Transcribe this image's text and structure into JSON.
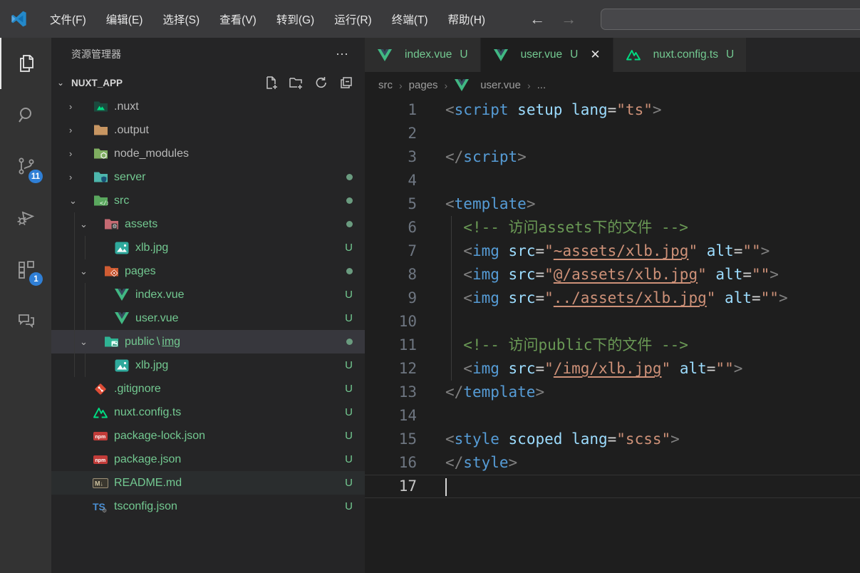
{
  "colors": {
    "titlebar_bg": "#3a3a3c",
    "activitybar_bg": "#333333",
    "sidebar_bg": "#252526",
    "editor_bg": "#1e1e1e",
    "tab_inactive_bg": "#2d2d2d",
    "selection_bg": "#37373d",
    "git_untracked_green": "#73c991",
    "badge_blue": "#2f7fd6",
    "tag_blue": "#569cd6",
    "attr_blue": "#9cdcfe",
    "string_orange": "#ce9178",
    "comment_green": "#6a9955"
  },
  "titlebar": {
    "logo_icon": "vscode-logo",
    "menus": [
      {
        "label": "文件(F)"
      },
      {
        "label": "编辑(E)"
      },
      {
        "label": "选择(S)"
      },
      {
        "label": "查看(V)"
      },
      {
        "label": "转到(G)"
      },
      {
        "label": "运行(R)"
      },
      {
        "label": "终端(T)"
      },
      {
        "label": "帮助(H)"
      }
    ],
    "nav": {
      "back": "←",
      "forward": "→"
    },
    "command_box_value": ""
  },
  "activity_bar": {
    "items": [
      {
        "name": "explorer",
        "icon": "files-icon",
        "active": true,
        "badge": ""
      },
      {
        "name": "search",
        "icon": "search-icon",
        "active": false,
        "badge": ""
      },
      {
        "name": "source-control",
        "icon": "source-control-icon",
        "active": false,
        "badge": "11"
      },
      {
        "name": "run-debug",
        "icon": "debug-icon",
        "active": false,
        "badge": ""
      },
      {
        "name": "extensions",
        "icon": "extensions-icon",
        "active": false,
        "badge": "1"
      },
      {
        "name": "chat",
        "icon": "chat-icon",
        "active": false,
        "badge": ""
      }
    ]
  },
  "sidebar": {
    "title": "资源管理器",
    "more_label": "⋯",
    "section": {
      "label": "NUXT_APP",
      "chevron": "⌄",
      "actions": [
        {
          "name": "new-file",
          "icon": "new-file-icon"
        },
        {
          "name": "new-folder",
          "icon": "new-folder-icon"
        },
        {
          "name": "refresh",
          "icon": "refresh-icon"
        },
        {
          "name": "collapse-all",
          "icon": "collapse-all-icon"
        }
      ]
    },
    "path_sep": "\\",
    "tree": [
      {
        "label": ".nuxt",
        "level": 0,
        "chevron": "›",
        "icon": "folder-nuxt-icon",
        "color": "dim"
      },
      {
        "label": ".output",
        "level": 0,
        "chevron": "›",
        "icon": "folder-output-icon",
        "color": "dim"
      },
      {
        "label": "node_modules",
        "level": 0,
        "chevron": "›",
        "icon": "folder-node-icon",
        "color": "dim"
      },
      {
        "label": "server",
        "level": 0,
        "chevron": "›",
        "icon": "folder-server-icon",
        "color": "green",
        "dot": true
      },
      {
        "label": "src",
        "level": 0,
        "chevron": "⌄",
        "icon": "folder-src-icon",
        "color": "green",
        "dot": true
      },
      {
        "label": "assets",
        "level": 1,
        "chevron": "⌄",
        "icon": "folder-assets-icon",
        "color": "green",
        "dot": true
      },
      {
        "label": "xlb.jpg",
        "level": 2,
        "chevron": "",
        "icon": "image-icon",
        "color": "green",
        "badge": "U"
      },
      {
        "label": "pages",
        "level": 1,
        "chevron": "⌄",
        "icon": "folder-pages-icon",
        "color": "green",
        "dot": true
      },
      {
        "label": "index.vue",
        "level": 2,
        "chevron": "",
        "icon": "vue-icon",
        "color": "green",
        "badge": "U"
      },
      {
        "label": "user.vue",
        "level": 2,
        "chevron": "",
        "icon": "vue-icon",
        "color": "green",
        "badge": "U"
      },
      {
        "label": "public",
        "label2": "img",
        "level": 1,
        "chevron": "⌄",
        "icon": "folder-public-icon",
        "color": "green",
        "dot": true,
        "selected": true
      },
      {
        "label": "xlb.jpg",
        "level": 2,
        "chevron": "",
        "icon": "image-icon",
        "color": "green",
        "badge": "U"
      },
      {
        "label": ".gitignore",
        "level": 0,
        "chevron": "",
        "icon": "git-icon",
        "color": "green",
        "badge": "U"
      },
      {
        "label": "nuxt.config.ts",
        "level": 0,
        "chevron": "",
        "icon": "nuxt-icon",
        "color": "green",
        "badge": "U"
      },
      {
        "label": "package-lock.json",
        "level": 0,
        "chevron": "",
        "icon": "npm-icon",
        "color": "green",
        "badge": "U"
      },
      {
        "label": "package.json",
        "level": 0,
        "chevron": "",
        "icon": "npm-icon",
        "color": "green",
        "badge": "U"
      },
      {
        "label": "README.md",
        "level": 0,
        "chevron": "",
        "icon": "markdown-icon",
        "color": "green",
        "badge": "U",
        "hovered": true
      },
      {
        "label": "tsconfig.json",
        "level": 0,
        "chevron": "",
        "icon": "tsconfig-icon",
        "color": "green",
        "badge": "U"
      }
    ]
  },
  "editor": {
    "tabs": [
      {
        "label": "index.vue",
        "badge": "U",
        "icon": "vue-icon",
        "active": false,
        "close": ""
      },
      {
        "label": "user.vue",
        "badge": "U",
        "icon": "vue-icon",
        "active": true,
        "close": "✕"
      },
      {
        "label": "nuxt.config.ts",
        "badge": "U",
        "icon": "nuxt-icon",
        "active": false,
        "close": ""
      }
    ],
    "breadcrumb": [
      {
        "label": "src"
      },
      {
        "label": "pages"
      },
      {
        "label": "user.vue",
        "icon": "vue-icon"
      },
      {
        "label": "..."
      }
    ],
    "code": {
      "language": "vue",
      "lines": [
        {
          "n": 1,
          "tokens": [
            [
              "p",
              "<"
            ],
            [
              "t",
              "script"
            ],
            [
              "w",
              " "
            ],
            [
              "a",
              "setup"
            ],
            [
              "w",
              " "
            ],
            [
              "a",
              "lang"
            ],
            [
              "o",
              "="
            ],
            [
              "s",
              "\"ts\""
            ],
            [
              "p",
              ">"
            ]
          ]
        },
        {
          "n": 2,
          "tokens": []
        },
        {
          "n": 3,
          "tokens": [
            [
              "p",
              "</"
            ],
            [
              "t",
              "script"
            ],
            [
              "p",
              ">"
            ]
          ]
        },
        {
          "n": 4,
          "tokens": []
        },
        {
          "n": 5,
          "tokens": [
            [
              "p",
              "<"
            ],
            [
              "t",
              "template"
            ],
            [
              "p",
              ">"
            ]
          ]
        },
        {
          "n": 6,
          "guide": true,
          "tokens": [
            [
              "w",
              "  "
            ],
            [
              "c",
              "<!-- 访问assets下的文件 -->"
            ]
          ]
        },
        {
          "n": 7,
          "guide": true,
          "tokens": [
            [
              "w",
              "  "
            ],
            [
              "p",
              "<"
            ],
            [
              "t",
              "img"
            ],
            [
              "w",
              " "
            ],
            [
              "a",
              "src"
            ],
            [
              "o",
              "="
            ],
            [
              "s",
              "\""
            ],
            [
              "l",
              "~assets/xlb.jpg"
            ],
            [
              "s",
              "\""
            ],
            [
              "w",
              " "
            ],
            [
              "a",
              "alt"
            ],
            [
              "o",
              "="
            ],
            [
              "s",
              "\"\""
            ],
            [
              "p",
              ">"
            ]
          ]
        },
        {
          "n": 8,
          "guide": true,
          "tokens": [
            [
              "w",
              "  "
            ],
            [
              "p",
              "<"
            ],
            [
              "t",
              "img"
            ],
            [
              "w",
              " "
            ],
            [
              "a",
              "src"
            ],
            [
              "o",
              "="
            ],
            [
              "s",
              "\""
            ],
            [
              "l",
              "@/assets/xlb.jpg"
            ],
            [
              "s",
              "\""
            ],
            [
              "w",
              " "
            ],
            [
              "a",
              "alt"
            ],
            [
              "o",
              "="
            ],
            [
              "s",
              "\"\""
            ],
            [
              "p",
              ">"
            ]
          ]
        },
        {
          "n": 9,
          "guide": true,
          "tokens": [
            [
              "w",
              "  "
            ],
            [
              "p",
              "<"
            ],
            [
              "t",
              "img"
            ],
            [
              "w",
              " "
            ],
            [
              "a",
              "src"
            ],
            [
              "o",
              "="
            ],
            [
              "s",
              "\""
            ],
            [
              "l",
              "../assets/xlb.jpg"
            ],
            [
              "s",
              "\""
            ],
            [
              "w",
              " "
            ],
            [
              "a",
              "alt"
            ],
            [
              "o",
              "="
            ],
            [
              "s",
              "\"\""
            ],
            [
              "p",
              ">"
            ]
          ]
        },
        {
          "n": 10,
          "guide": true,
          "tokens": []
        },
        {
          "n": 11,
          "guide": true,
          "tokens": [
            [
              "w",
              "  "
            ],
            [
              "c",
              "<!-- 访问public下的文件 -->"
            ]
          ]
        },
        {
          "n": 12,
          "guide": true,
          "tokens": [
            [
              "w",
              "  "
            ],
            [
              "p",
              "<"
            ],
            [
              "t",
              "img"
            ],
            [
              "w",
              " "
            ],
            [
              "a",
              "src"
            ],
            [
              "o",
              "="
            ],
            [
              "s",
              "\""
            ],
            [
              "l",
              "/img/xlb.jpg"
            ],
            [
              "s",
              "\""
            ],
            [
              "w",
              " "
            ],
            [
              "a",
              "alt"
            ],
            [
              "o",
              "="
            ],
            [
              "s",
              "\"\""
            ],
            [
              "p",
              ">"
            ]
          ]
        },
        {
          "n": 13,
          "tokens": [
            [
              "p",
              "</"
            ],
            [
              "t",
              "template"
            ],
            [
              "p",
              ">"
            ]
          ]
        },
        {
          "n": 14,
          "tokens": []
        },
        {
          "n": 15,
          "tokens": [
            [
              "p",
              "<"
            ],
            [
              "t",
              "style"
            ],
            [
              "w",
              " "
            ],
            [
              "a",
              "scoped"
            ],
            [
              "w",
              " "
            ],
            [
              "a",
              "lang"
            ],
            [
              "o",
              "="
            ],
            [
              "s",
              "\"scss\""
            ],
            [
              "p",
              ">"
            ]
          ]
        },
        {
          "n": 16,
          "tokens": [
            [
              "p",
              "</"
            ],
            [
              "t",
              "style"
            ],
            [
              "p",
              ">"
            ]
          ]
        },
        {
          "n": 17,
          "tokens": [],
          "current": true
        }
      ]
    }
  }
}
